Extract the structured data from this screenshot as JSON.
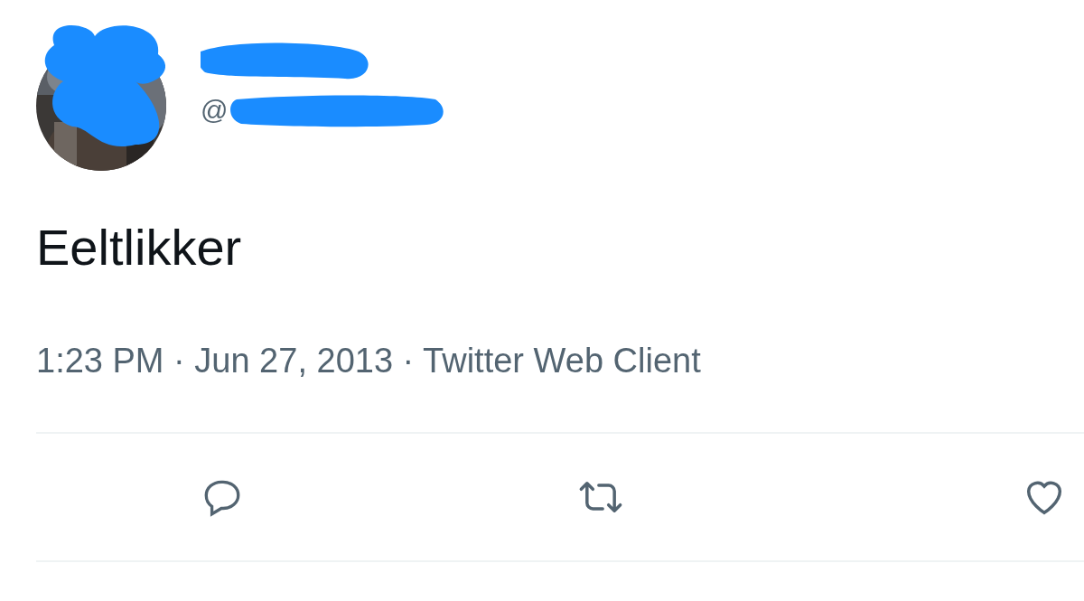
{
  "author": {
    "handle": "@"
  },
  "tweet": {
    "text": "Eeltlikker",
    "meta": "1:23 PM · Jun 27, 2013 · Twitter Web Client"
  }
}
